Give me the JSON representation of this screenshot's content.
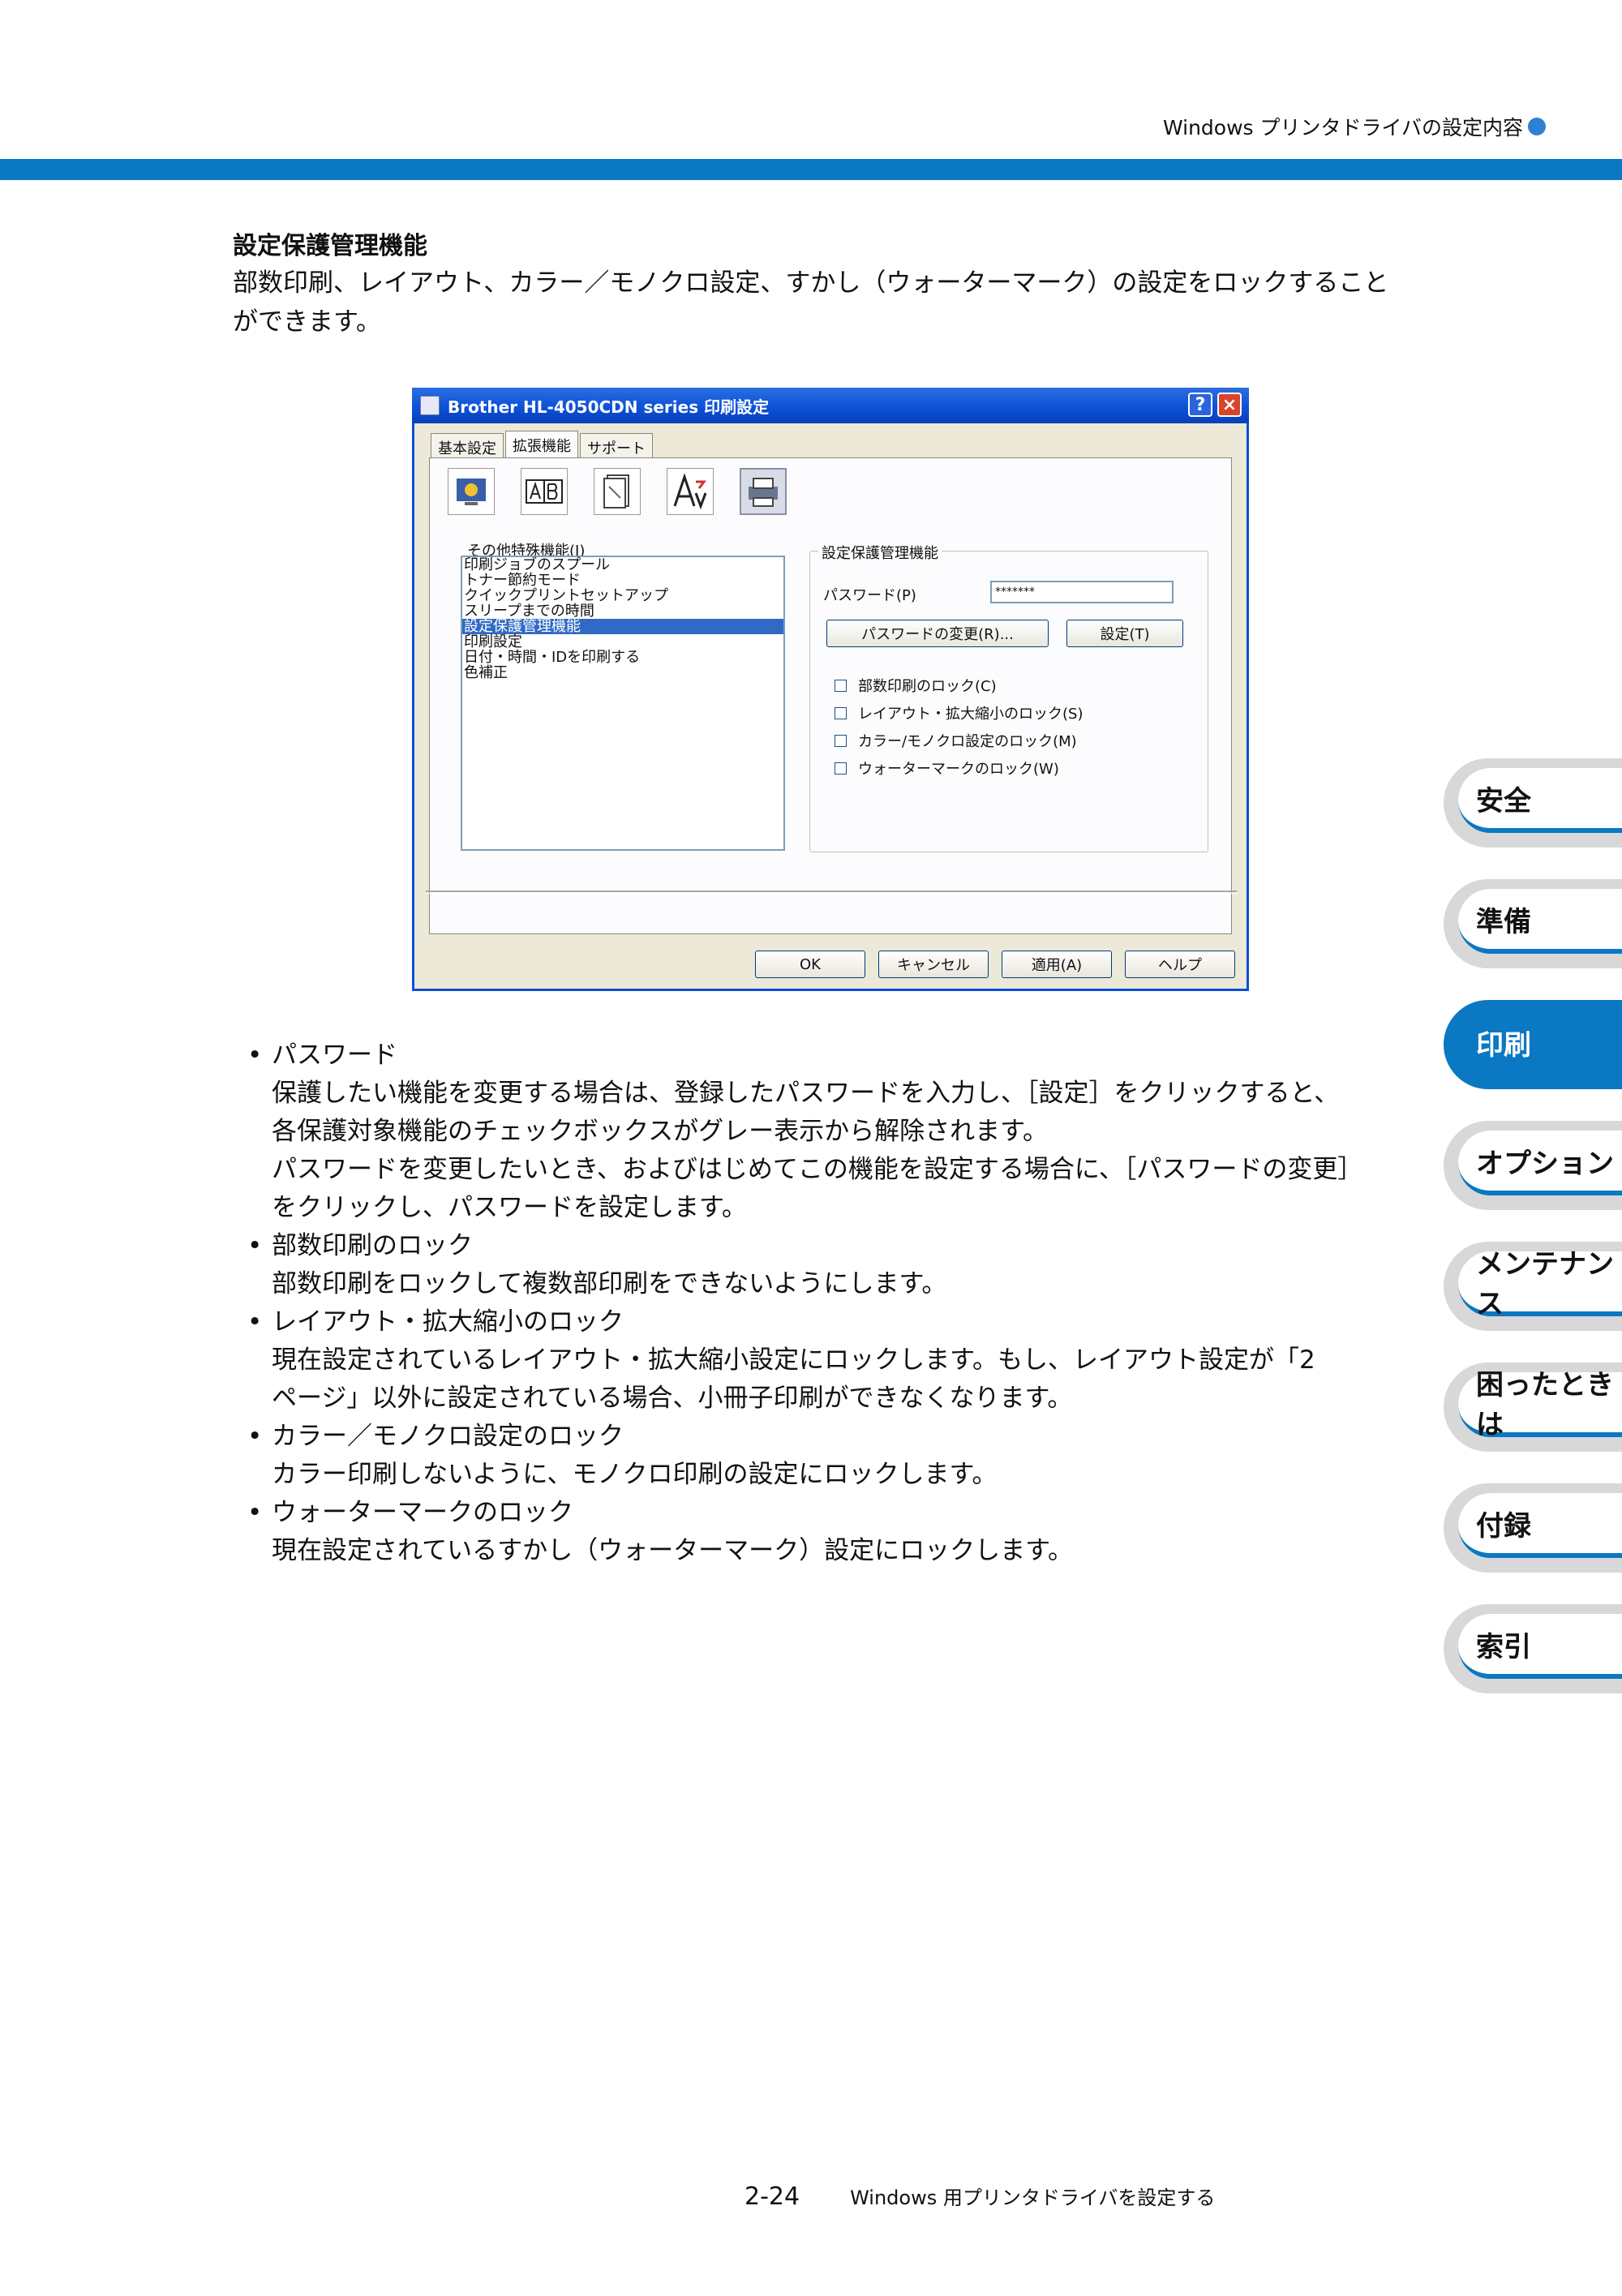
{
  "header": {
    "text": "Windows プリンタドライバの設定内容"
  },
  "section": {
    "title": "設定保護管理機能",
    "intro_line1": "部数印刷、レイアウト、カラー／モノクロ設定、すかし（ウォーターマーク）の設定をロックすること",
    "intro_line2": "ができます。"
  },
  "dialog": {
    "title": "Brother HL-4050CDN series 印刷設定",
    "tabs": [
      "基本設定",
      "拡張機能",
      "サポート"
    ],
    "icons": [
      "monitor-icon",
      "ab-icon",
      "copy-icon",
      "font-icon",
      "printer-icon"
    ],
    "list_label": "その他特殊機能(I)",
    "list_items": [
      "印刷ジョブのスプール",
      "トナー節約モード",
      "クイックプリントセットアップ",
      "スリープまでの時間",
      "設定保護管理機能",
      "印刷設定",
      "日付・時間・IDを印刷する",
      "色補正"
    ],
    "group_title": "設定保護管理機能",
    "password_label": "パスワード(P)",
    "password_value": "*******",
    "change_pw_button": "パスワードの変更(R)...",
    "set_button": "設定(T)",
    "checkboxes": [
      "部数印刷のロック(C)",
      "レイアウト・拡大縮小のロック(S)",
      "カラー/モノクロ設定のロック(M)",
      "ウォーターマークのロック(W)"
    ],
    "ok": "OK",
    "cancel": "キャンセル",
    "apply": "適用(A)",
    "help": "ヘルプ"
  },
  "bullets": [
    {
      "title": "パスワード",
      "lines": [
        "保護したい機能を変更する場合は、登録したパスワードを入力し、［設定］をクリックすると、",
        "各保護対象機能のチェックボックスがグレー表示から解除されます。",
        "パスワードを変更したいとき、およびはじめてこの機能を設定する場合に、［パスワードの変更］",
        "をクリックし、パスワードを設定します。"
      ]
    },
    {
      "title": "部数印刷のロック",
      "lines": [
        "部数印刷をロックして複数部印刷をできないようにします。"
      ]
    },
    {
      "title": "レイアウト・拡大縮小のロック",
      "lines": [
        "現在設定されているレイアウト・拡大縮小設定にロックします。もし、レイアウト設定が「2",
        "ページ」以外に設定されている場合、小冊子印刷ができなくなります。"
      ]
    },
    {
      "title": "カラー／モノクロ設定のロック",
      "lines": [
        "カラー印刷しないように、モノクロ印刷の設定にロックします。"
      ]
    },
    {
      "title": "ウォーターマークのロック",
      "lines": [
        "現在設定されているすかし（ウォーターマーク）設定にロックします。"
      ]
    }
  ],
  "side_tabs": [
    "安全",
    "準備",
    "印刷",
    "オプション",
    "メンテナンス",
    "困ったときは",
    "付録",
    "索引"
  ],
  "side_tabs_active": "印刷",
  "footer": {
    "page": "2-24",
    "text": "Windows 用プリンタドライバを設定する"
  },
  "colors": {
    "accent": "#0a78c2",
    "selection": "#316ac5"
  }
}
